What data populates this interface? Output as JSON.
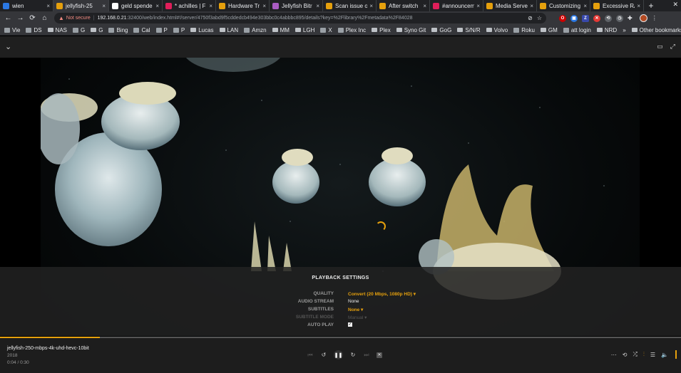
{
  "browser": {
    "tabs": [
      {
        "title": "wien",
        "icon": "outlook",
        "color": "#2b78e4",
        "active": false
      },
      {
        "title": "jellyfish-25",
        "icon": "plex",
        "color": "#e5a00d",
        "active": true
      },
      {
        "title": "geld spende",
        "icon": "github",
        "color": "#ffffff",
        "active": false
      },
      {
        "title": "* achilles | F",
        "icon": "slack",
        "color": "#e01e5a",
        "active": false
      },
      {
        "title": "Hardware Tr",
        "icon": "plex",
        "color": "#e5a00d",
        "active": false
      },
      {
        "title": "Jellyfish Bitr",
        "icon": "jellyfish",
        "color": "#aa5cc3",
        "active": false
      },
      {
        "title": "Scan issue o",
        "icon": "plex",
        "color": "#e5a00d",
        "active": false
      },
      {
        "title": "After switch",
        "icon": "plex",
        "color": "#e5a00d",
        "active": false
      },
      {
        "title": "#announcem",
        "icon": "slack",
        "color": "#e01e5a",
        "active": false
      },
      {
        "title": "Media Serve",
        "icon": "plex",
        "color": "#e5a00d",
        "active": false
      },
      {
        "title": "Customizing",
        "icon": "plex",
        "color": "#e5a00d",
        "active": false
      },
      {
        "title": "Excessive RA",
        "icon": "plex",
        "color": "#e5a00d",
        "active": false
      }
    ],
    "new_tab": "+",
    "close_tab": "×",
    "address": {
      "security_label": "Not secure",
      "host": "192.168.0.21",
      "path": ":32400/web/index.html#!/server/4750f3abd9f5cddedcb494e303bbc0c4abbbc895/details?key=%2Flibrary%2Fmetadata%2F84028"
    },
    "bookmarks": [
      {
        "label": "Vie",
        "kind": "site"
      },
      {
        "label": "DS",
        "kind": "site"
      },
      {
        "label": "NAS",
        "kind": "folder"
      },
      {
        "label": "G",
        "kind": "site"
      },
      {
        "label": "G",
        "kind": "folder"
      },
      {
        "label": "Bing",
        "kind": "site"
      },
      {
        "label": "Cal",
        "kind": "site"
      },
      {
        "label": "P",
        "kind": "site"
      },
      {
        "label": "P",
        "kind": "site"
      },
      {
        "label": "Lucas",
        "kind": "folder"
      },
      {
        "label": "LAN",
        "kind": "folder"
      },
      {
        "label": "Amzn",
        "kind": "site"
      },
      {
        "label": "MM",
        "kind": "folder"
      },
      {
        "label": "LGH",
        "kind": "folder"
      },
      {
        "label": "X",
        "kind": "site"
      },
      {
        "label": "Plex Inc",
        "kind": "site"
      },
      {
        "label": "Plex",
        "kind": "folder"
      },
      {
        "label": "Syno Git",
        "kind": "folder"
      },
      {
        "label": "GoG",
        "kind": "folder"
      },
      {
        "label": "S/N/R",
        "kind": "folder"
      },
      {
        "label": "Volvo",
        "kind": "folder"
      },
      {
        "label": "Roku",
        "kind": "site"
      },
      {
        "label": "GM",
        "kind": "folder"
      },
      {
        "label": "att login",
        "kind": "site"
      },
      {
        "label": "NRD",
        "kind": "folder"
      }
    ],
    "more_bookmarks": "»",
    "other_bookmarks": "Other bookmarks"
  },
  "player": {
    "settings": {
      "title": "PLAYBACK SETTINGS",
      "rows": [
        {
          "label": "QUALITY",
          "value": "Convert (20 Mbps, 1080p HD) ▾",
          "accent": true,
          "disabled": false
        },
        {
          "label": "AUDIO STREAM",
          "value": "None",
          "accent": false,
          "disabled": false
        },
        {
          "label": "SUBTITLES",
          "value": "None ▾",
          "accent": true,
          "disabled": false
        },
        {
          "label": "SUBTITLE MODE",
          "value": "Manual ▾",
          "accent": false,
          "disabled": true
        }
      ],
      "autoplay": {
        "label": "AUTO PLAY",
        "checked": true
      }
    },
    "media": {
      "title": "jellyfish-250-mbps-4k-uhd-hevc-10bit",
      "year": "2018",
      "time": "0:04 / 0:30",
      "progress": 0.147
    }
  },
  "colors": {
    "accent": "#e5a00d",
    "panel": "#222222"
  }
}
